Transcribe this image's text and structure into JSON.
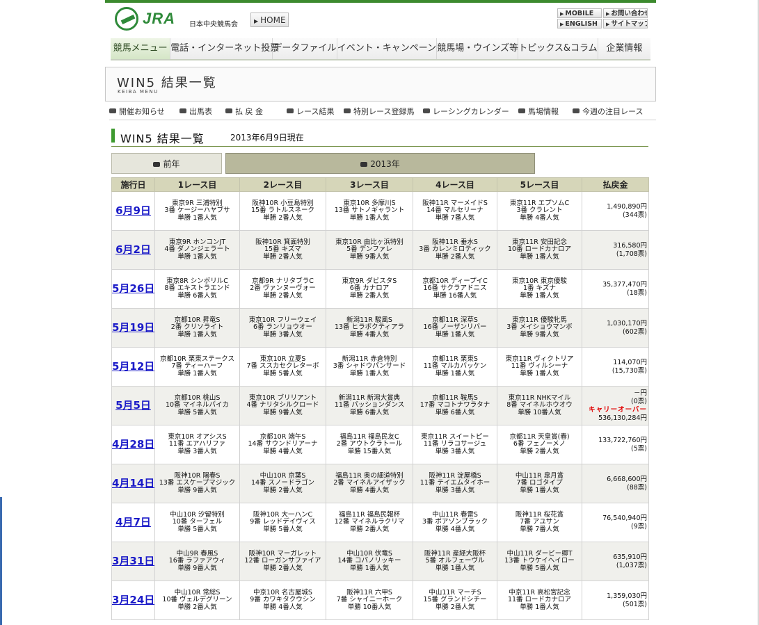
{
  "header": {
    "logo_text": "JRA",
    "org_name": "日本中央競馬会",
    "home_label": "HOME",
    "util_links": [
      "MOBILE",
      "お問い合わせ",
      "ENGLISH",
      "サイトマップ"
    ]
  },
  "main_nav": [
    "競馬メニュー",
    "電話・インターネット投票",
    "データファイル",
    "イベント・キャンペーン",
    "競馬場・ウインズ等",
    "トピックス&コラム",
    "企業情報"
  ],
  "title_box": {
    "title": "WIN5 結果一覧",
    "subtitle": "KEIBA MENU"
  },
  "sub_nav": [
    "開催お知らせ",
    "出馬表",
    "払 戻 金",
    "レース結果",
    "特別レース登録馬",
    "レーシングカレンダー",
    "馬場情報",
    "今週の注目レース"
  ],
  "heading": {
    "title": "WIN5 結果一覧",
    "date": "2013年6月9日現在"
  },
  "tabs": {
    "prev": "前年",
    "current": "2013年"
  },
  "table": {
    "headers": [
      "施行日",
      "1レース目",
      "2レース目",
      "3レース目",
      "4レース目",
      "5レース目",
      "払戻金"
    ],
    "rows": [
      {
        "date": "6月9日",
        "races": [
          [
            "東京9R 三浦特別",
            "3番 ケージーハヤブサ",
            "単勝 1番人気"
          ],
          [
            "阪神10R 小豆島特別",
            "15番 ラトルスネーク",
            "単勝 2番人気"
          ],
          [
            "東京10R 多摩川S",
            "13番 サトノギャラント",
            "単勝 1番人気"
          ],
          [
            "阪神11R マーメイドS",
            "14番 マルセリーナ",
            "単勝 7番人気"
          ],
          [
            "東京11R エプソムC",
            "3番 クラレント",
            "単勝 4番人気"
          ]
        ],
        "payout": [
          "1,490,890円",
          "(344票)"
        ]
      },
      {
        "date": "6月2日",
        "races": [
          [
            "東京9R ホンコンJT",
            "4番 ダノンジェラート",
            "単勝 1番人気"
          ],
          [
            "阪神10R 箕面特別",
            "15番 キズマ",
            "単勝 2番人気"
          ],
          [
            "東京10R 由比ヶ浜特別",
            "5番 デンファレ",
            "単勝 9番人気"
          ],
          [
            "阪神11R 垂水S",
            "3番 カレンミロティック",
            "単勝 2番人気"
          ],
          [
            "東京11R 安田記念",
            "10番 ロードカナロア",
            "単勝 1番人気"
          ]
        ],
        "payout": [
          "316,580円",
          "(1,708票)"
        ]
      },
      {
        "date": "5月26日",
        "races": [
          [
            "東京8R シンボリルC",
            "8番 エキストラエンド",
            "単勝 6番人気"
          ],
          [
            "京都9R ナリタブラC",
            "2番 ヴァンヌーヴォー",
            "単勝 2番人気"
          ],
          [
            "東京9R ダビスタS",
            "6番 カナロア",
            "単勝 2番人気"
          ],
          [
            "京都10R ディープイC",
            "16番 サクラアドニス",
            "単勝 16番人気"
          ],
          [
            "東京10R 東京優駿",
            "1番 キズナ",
            "単勝 1番人気"
          ]
        ],
        "payout": [
          "35,377,470円",
          "(18票)"
        ]
      },
      {
        "date": "5月19日",
        "races": [
          [
            "京都10R 昇竜S",
            "2番 クリソライト",
            "単勝 1番人気"
          ],
          [
            "東京10R フリーウェイ",
            "6番 ランリョウオー",
            "単勝 3番人気"
          ],
          [
            "新潟11R 駿風S",
            "13番 ヒラボクティアラ",
            "単勝 4番人気"
          ],
          [
            "京都11R 深草S",
            "16番 ノーザンリバー",
            "単勝 1番人気"
          ],
          [
            "東京11R 優駿牝馬",
            "3番 メイショウマンボ",
            "単勝 9番人気"
          ]
        ],
        "payout": [
          "1,030,170円",
          "(602票)"
        ]
      },
      {
        "date": "5月12日",
        "races": [
          [
            "京都10R 栗東ステークス",
            "7番 ティーハーフ",
            "単勝 1番人気"
          ],
          [
            "東京10R 立夏S",
            "7番 ススカセクレターボ",
            "単勝 5番人気"
          ],
          [
            "新潟11R 赤倉特別",
            "3番 シャドウパンサード",
            "単勝 1番人気"
          ],
          [
            "京都11R 栗東S",
            "11番 マルカバッケン",
            "単勝 1番人気"
          ],
          [
            "東京11R ヴィクトリア",
            "11番 ヴィルシーナ",
            "単勝 1番人気"
          ]
        ],
        "payout": [
          "114,070円",
          "(15,730票)"
        ]
      },
      {
        "date": "5月5日",
        "races": [
          [
            "京都10R 桃山S",
            "10番 マイネルバイカ",
            "単勝 5番人気"
          ],
          [
            "東京10R ブリリアント",
            "4番 ナリタシルクロード",
            "単勝 9番人気"
          ],
          [
            "新潟11R 新潟大賞典",
            "11番 パッションダンス",
            "単勝 6番人気"
          ],
          [
            "京都11R 鞍馬S",
            "17番 マコトナワラタナ",
            "単勝 6番人気"
          ],
          [
            "東京11R NHKマイル",
            "8番 マイネルホウオウ",
            "単勝 10番人気"
          ]
        ],
        "payout": [
          "－円",
          "(0票)",
          "キャリーオーバー",
          "536,130,284円"
        ]
      },
      {
        "date": "4月28日",
        "races": [
          [
            "東京10R オアシスS",
            "11番 エアハリファ",
            "単勝 3番人気"
          ],
          [
            "京都10R 端午S",
            "14番 サウンドリアーナ",
            "単勝 4番人気"
          ],
          [
            "福島11R 福島民友C",
            "2番 アウトクラトール",
            "単勝 15番人気"
          ],
          [
            "東京11R スイートピー",
            "11番 リラコサージュ",
            "単勝 3番人気"
          ],
          [
            "京都11R 天皇賞(春)",
            "6番 フェノーメノ",
            "単勝 2番人気"
          ]
        ],
        "payout": [
          "133,722,760円",
          "(5票)"
        ]
      },
      {
        "date": "4月14日",
        "races": [
          [
            "阪神10R 陽春S",
            "13番 エスケープマジック",
            "単勝 9番人気"
          ],
          [
            "中山10R 京葉S",
            "14番 スノードラゴン",
            "単勝 2番人気"
          ],
          [
            "福島11R 奥の細道特別",
            "2番 マイネルアイザック",
            "単勝 4番人気"
          ],
          [
            "阪神11R 淀屋橋S",
            "11番 テイエムタイホー",
            "単勝 3番人気"
          ],
          [
            "中山11R 皐月賞",
            "7番 ロゴタイプ",
            "単勝 1番人気"
          ]
        ],
        "payout": [
          "6,668,600円",
          "(88票)"
        ]
      },
      {
        "date": "4月7日",
        "races": [
          [
            "中山10R 汐留特別",
            "10番 ターフェル",
            "単勝 5番人気"
          ],
          [
            "阪神10R 大一ハンC",
            "9番 レッドデイヴィス",
            "単勝 5番人気"
          ],
          [
            "福島11R 福島民報杯",
            "12番 マイネルラクリマ",
            "単勝 2番人気"
          ],
          [
            "中山11R 春雷S",
            "3番 ポアゾンブラック",
            "単勝 4番人気"
          ],
          [
            "阪神11R 桜花賞",
            "7番 アユサン",
            "単勝 7番人気"
          ]
        ],
        "payout": [
          "76,540,940円",
          "(9票)"
        ]
      },
      {
        "date": "3月31日",
        "races": [
          [
            "中山9R 春風S",
            "16番 ラファアウィ",
            "単勝 9番人気"
          ],
          [
            "阪神10R マーガレット",
            "12番 ローガンサファイア",
            "単勝 2番人気"
          ],
          [
            "中山10R 伏竜S",
            "14番 コパノリッキー",
            "単勝 1番人気"
          ],
          [
            "阪神11R 産経大阪杯",
            "5番 オルフェーヴル",
            "単勝 1番人気"
          ],
          [
            "中山11R ダービー卿T",
            "13番 トウケイヘイロー",
            "単勝 5番人気"
          ]
        ],
        "payout": [
          "635,910円",
          "(1,037票)"
        ]
      },
      {
        "date": "3月24日",
        "races": [
          [
            "中山10R 常総S",
            "10番 ヴェルデグリーン",
            "単勝 2番人気"
          ],
          [
            "中京10R 名古屋城S",
            "9番 カワキタクウシン",
            "単勝 4番人気"
          ],
          [
            "阪神11R 六甲S",
            "7番 シャイニーホーク",
            "単勝 10番人気"
          ],
          [
            "中山11R マーチS",
            "15番 グランドシチー",
            "単勝 2番人気"
          ],
          [
            "中京11R 高松宮記念",
            "11番 ロードカナロア",
            "単勝 1番人気"
          ]
        ],
        "payout": [
          "1,359,030円",
          "(501票)"
        ]
      }
    ]
  }
}
